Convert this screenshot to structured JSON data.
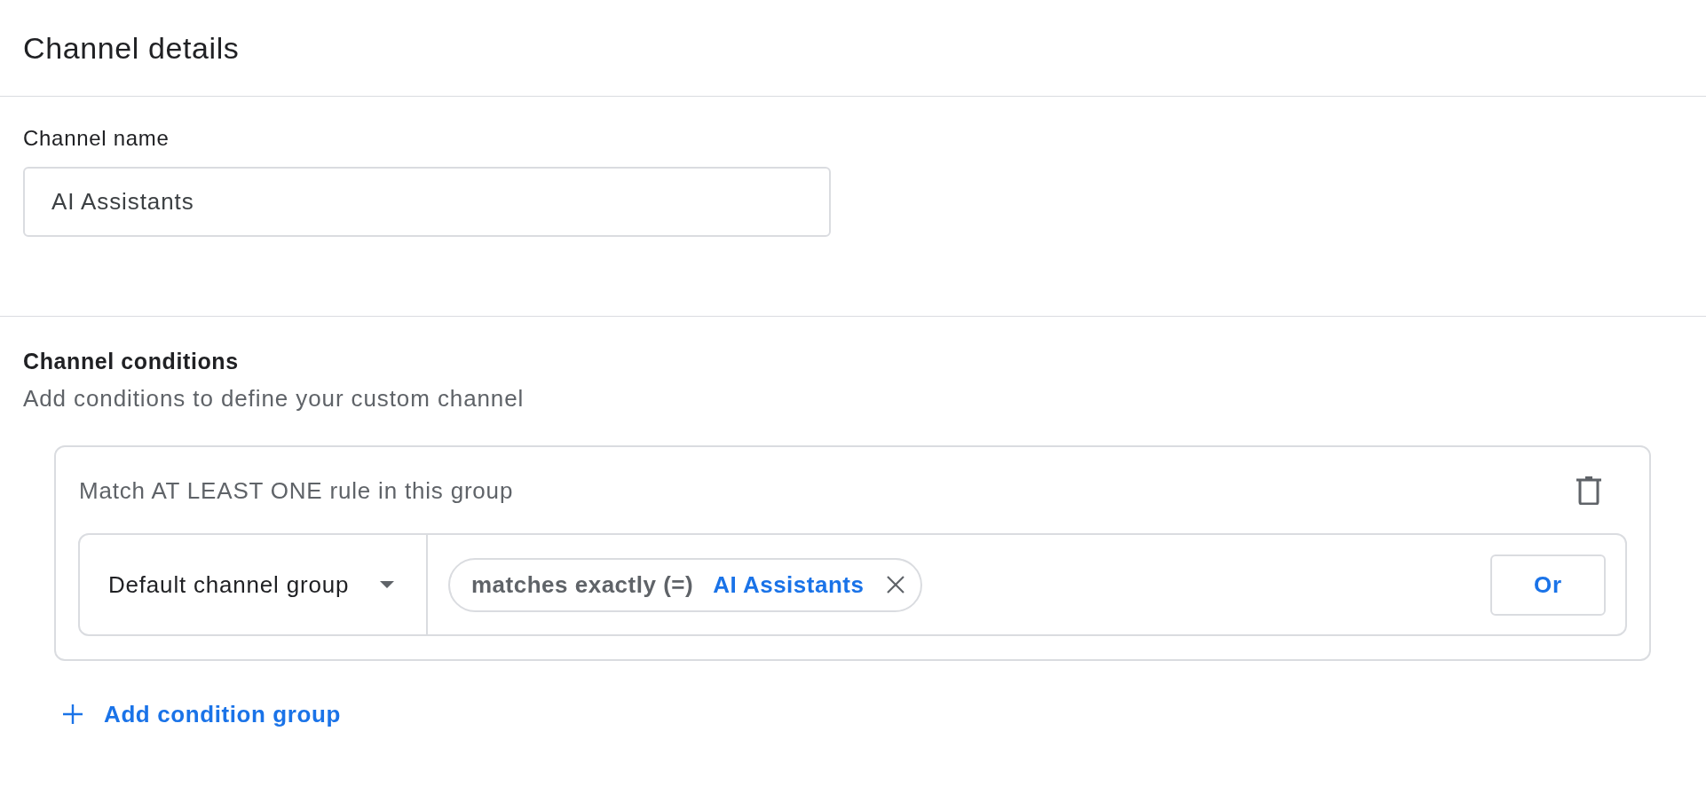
{
  "header": {
    "title": "Channel details"
  },
  "channel_name": {
    "label": "Channel name",
    "value": "AI Assistants"
  },
  "conditions": {
    "title": "Channel conditions",
    "subtitle": "Add conditions to define your custom channel",
    "groups": [
      {
        "heading": "Match AT LEAST ONE rule in this group",
        "rules": [
          {
            "dimension": "Default channel group",
            "chips": [
              {
                "operator": "matches exactly (=)",
                "value": "AI Assistants"
              }
            ],
            "or_button": "Or"
          }
        ]
      }
    ],
    "add_group_button": "Add condition group"
  }
}
